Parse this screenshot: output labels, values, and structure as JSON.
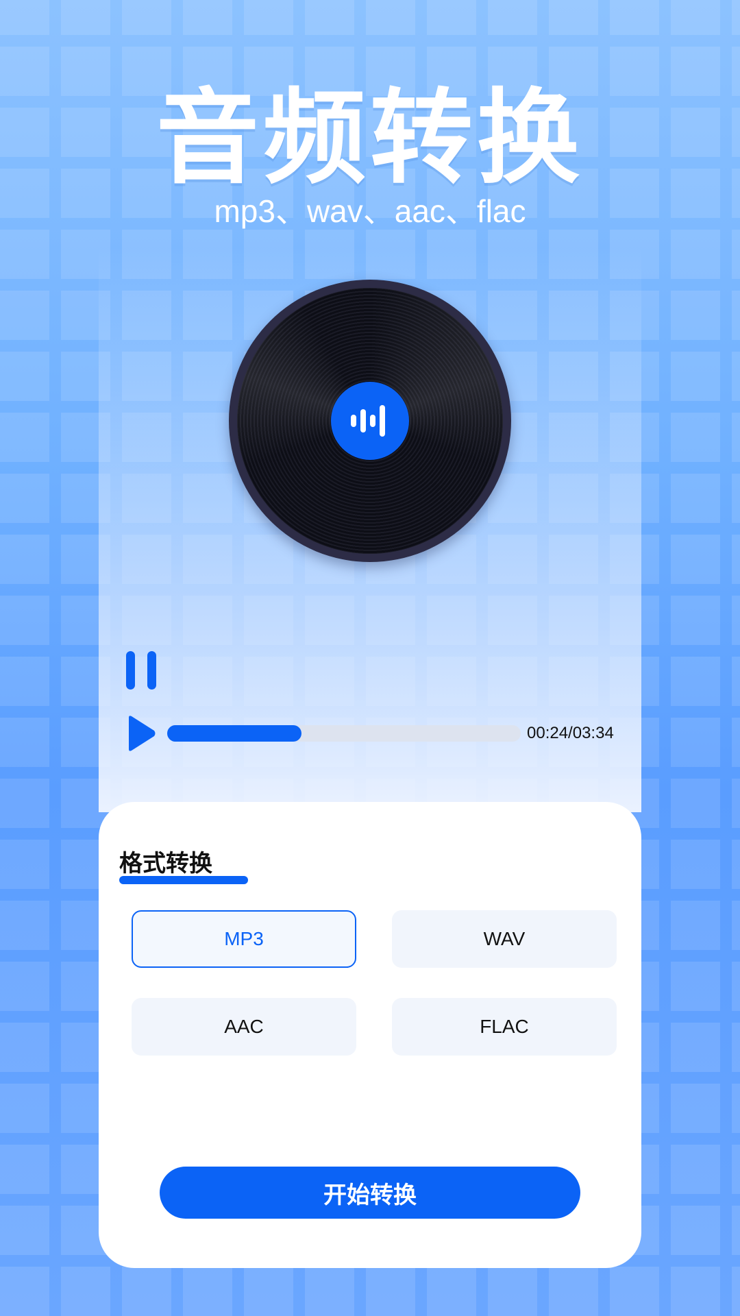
{
  "hero": {
    "title": "音频转换",
    "subtitle": "mp3、wav、aac、flac"
  },
  "player": {
    "time": "00:24/03:34",
    "progress_fraction": 0.38,
    "pause_icon": "pause-icon",
    "play_icon": "play-icon",
    "disc_icon": "audio-wave-icon"
  },
  "converter": {
    "title": "格式转换",
    "formats": [
      "MP3",
      "WAV",
      "AAC",
      "FLAC"
    ],
    "selected_format": "MP3",
    "start_label": "开始转换"
  },
  "colors": {
    "accent": "#0b63f6",
    "option_bg": "#f1f5fc",
    "track": "#dde3ef"
  }
}
